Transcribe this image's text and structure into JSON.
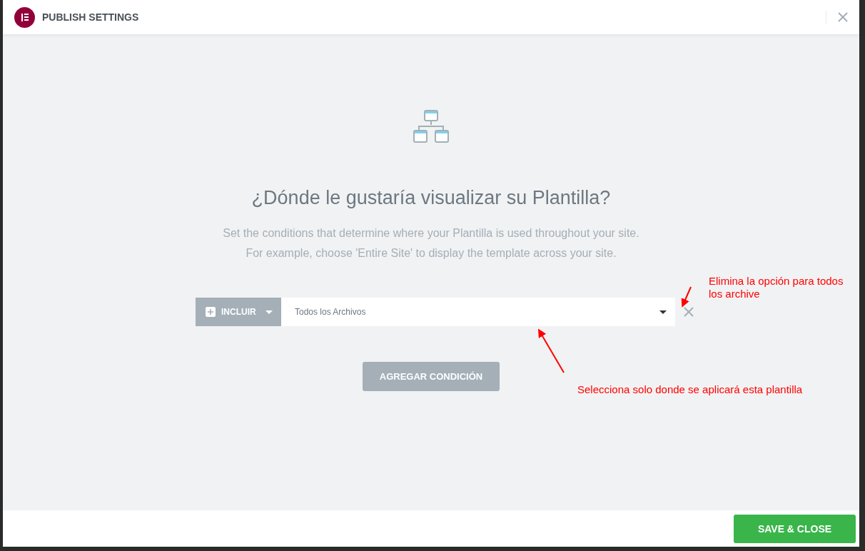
{
  "dialog": {
    "title": "PUBLISH SETTINGS"
  },
  "heading": "¿Dónde le gustaría visualizar su Plantilla?",
  "description": [
    "Set the conditions that determine where your Plantilla is used throughout your site.",
    "For example, choose 'Entire Site' to display the template across your site."
  ],
  "conditions": [
    {
      "type": "INCLUIR",
      "value": "Todos los Archivos"
    }
  ],
  "add_button": "AGREGAR CONDICIÓN",
  "annotations": [
    {
      "text": "Elimina la opción para todos los archive"
    },
    {
      "text": "Selecciona solo donde se aplicará esta plantilla"
    }
  ],
  "footer": {
    "button": "SAVE & CLOSE"
  }
}
